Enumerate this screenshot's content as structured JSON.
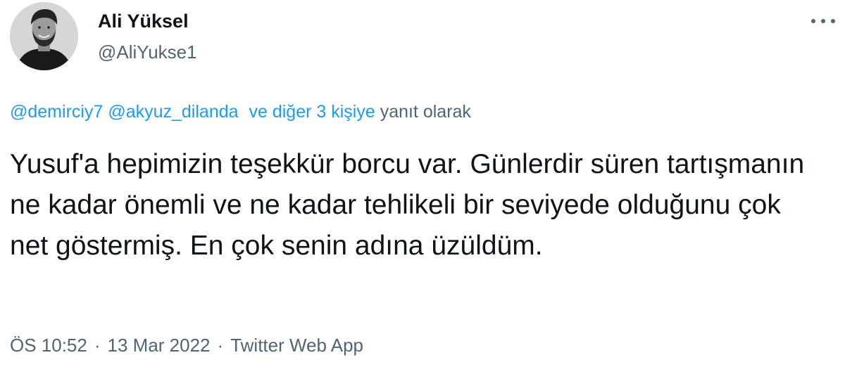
{
  "author": {
    "display_name": "Ali Yüksel",
    "handle": "@AliYukse1"
  },
  "reply": {
    "mention_1": "@demirciy7",
    "mention_2": "@akyuz_dilanda",
    "others": "ve diğer 3 kişiye",
    "suffix": "yanıt olarak"
  },
  "tweet": {
    "text": "Yusuf'a hepimizin teşekkür borcu var. Günlerdir süren tartışmanın ne kadar önemli ve ne kadar tehlikeli bir seviyede olduğunu çok net göstermiş. En çok senin adına üzüldüm."
  },
  "meta": {
    "time": "ÖS 10:52",
    "separator": "·",
    "date": "13 Mar 2022",
    "source": "Twitter Web App"
  },
  "icons": {
    "more": "more-horizontal-icon"
  },
  "colors": {
    "link": "#1d9bf0",
    "secondary": "#536471",
    "primary_text": "#0f1419"
  }
}
